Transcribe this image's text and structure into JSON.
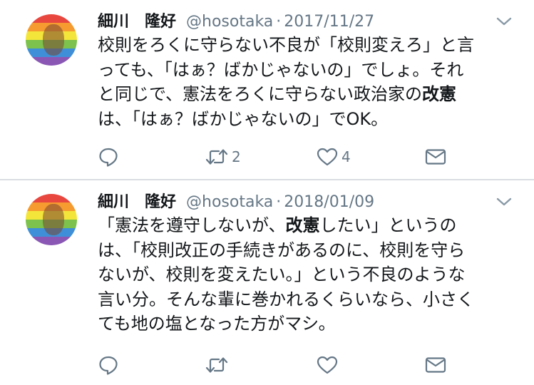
{
  "tweets": [
    {
      "author_name": "細川　隆好",
      "handle": "@hosotaka",
      "separator": "·",
      "date": "2017/11/27",
      "lines": [
        [
          {
            "t": "校則をろくに守らない不良が「校則変えろ」と言"
          }
        ],
        [
          {
            "t": "っても、「はぁ？ばかじゃないの」でしょ。それ"
          }
        ],
        [
          {
            "t": "と同じで、憲法をろくに守らない政治家の"
          },
          {
            "t": "改憲",
            "b": true
          }
        ],
        [
          {
            "t": "は、「はぁ？ばかじゃないの」でOK。"
          }
        ]
      ],
      "reply_count": "",
      "retweet_count": "2",
      "like_count": "4"
    },
    {
      "author_name": "細川　隆好",
      "handle": "@hosotaka",
      "separator": "·",
      "date": "2018/01/09",
      "lines": [
        [
          {
            "t": "「憲法を遵守しないが、"
          },
          {
            "t": "改憲",
            "b": true
          },
          {
            "t": "したい」というの"
          }
        ],
        [
          {
            "t": "は、「校則改正の手続きがあるのに、校則を守ら"
          }
        ],
        [
          {
            "t": "ないが、校則を変えたい。」という不良のような"
          }
        ],
        [
          {
            "t": "言い分。そんな輩に巻かれるくらいなら、小さく"
          }
        ],
        [
          {
            "t": "ても地の塩となった方がマシ。"
          }
        ]
      ],
      "reply_count": "",
      "retweet_count": "",
      "like_count": ""
    }
  ],
  "icons": {
    "reply": "speech-bubble-icon",
    "retweet": "retweet-arrows-icon",
    "like": "heart-icon",
    "dm": "envelope-icon",
    "more": "chevron-down-icon"
  },
  "colors": {
    "text": "#14171a",
    "secondary": "#657786",
    "divider": "#d9dde1",
    "avatar_bands": [
      "#e8473f",
      "#f59b2f",
      "#f4e53b",
      "#7cc24c",
      "#3f8fd8",
      "#8a57b5"
    ]
  }
}
